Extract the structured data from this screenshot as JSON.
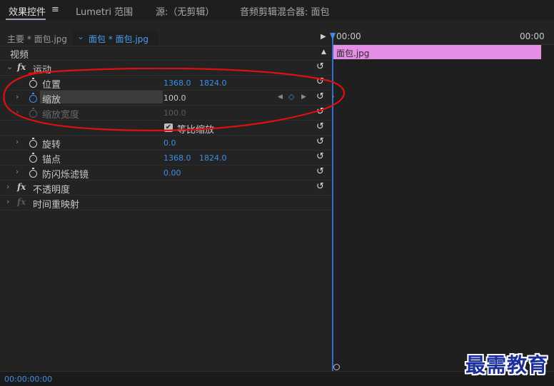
{
  "tabs": {
    "effect_controls": "效果控件",
    "menu_icon": "≡",
    "lumetri": "Lumetri 范围",
    "source": "源:（无剪辑）",
    "audio_mixer": "音频剪辑混合器: 面包"
  },
  "clip_header": {
    "master": "主要 * 面包.jpg",
    "sequence_chevron": "⌄",
    "sequence": "面包 * 面包.jpg"
  },
  "sections": {
    "video": "视频"
  },
  "effects": {
    "motion": {
      "fx": "fx",
      "label": "运动",
      "position": {
        "label": "位置",
        "x": "1368.0",
        "y": "1824.0"
      },
      "scale": {
        "label": "缩放",
        "value": "100.0"
      },
      "scale_width": {
        "label": "缩放宽度",
        "value": "100.0"
      },
      "uniform_scale": {
        "label": "等比缩放",
        "checked": true
      },
      "rotation": {
        "label": "旋转",
        "value": "0.0"
      },
      "anchor": {
        "label": "锚点",
        "x": "1368.0",
        "y": "1824.0"
      },
      "anti_flicker": {
        "label": "防闪烁滤镜",
        "value": "0.00"
      }
    },
    "opacity": {
      "fx": "fx",
      "label": "不透明度"
    },
    "time_remap": {
      "fx": "fx",
      "label": "时间重映射"
    }
  },
  "timeline": {
    "start": "00:00",
    "end": "00:00",
    "clip_name": "面包.jpg"
  },
  "footer": {
    "timecode": "00:00:00:00"
  },
  "watermark": "最需教育",
  "icons": {
    "reset": "↺",
    "chevron_right": "›",
    "chevron_down": "⌄",
    "play": "▶",
    "collapse_up": "▲",
    "kf_prev": "◀",
    "kf_next": "▶",
    "kf_add": "◇"
  },
  "colors": {
    "accent_blue": "#3b8ee8",
    "clip_pink": "#e68ee6",
    "annotation_red": "#e01010"
  }
}
